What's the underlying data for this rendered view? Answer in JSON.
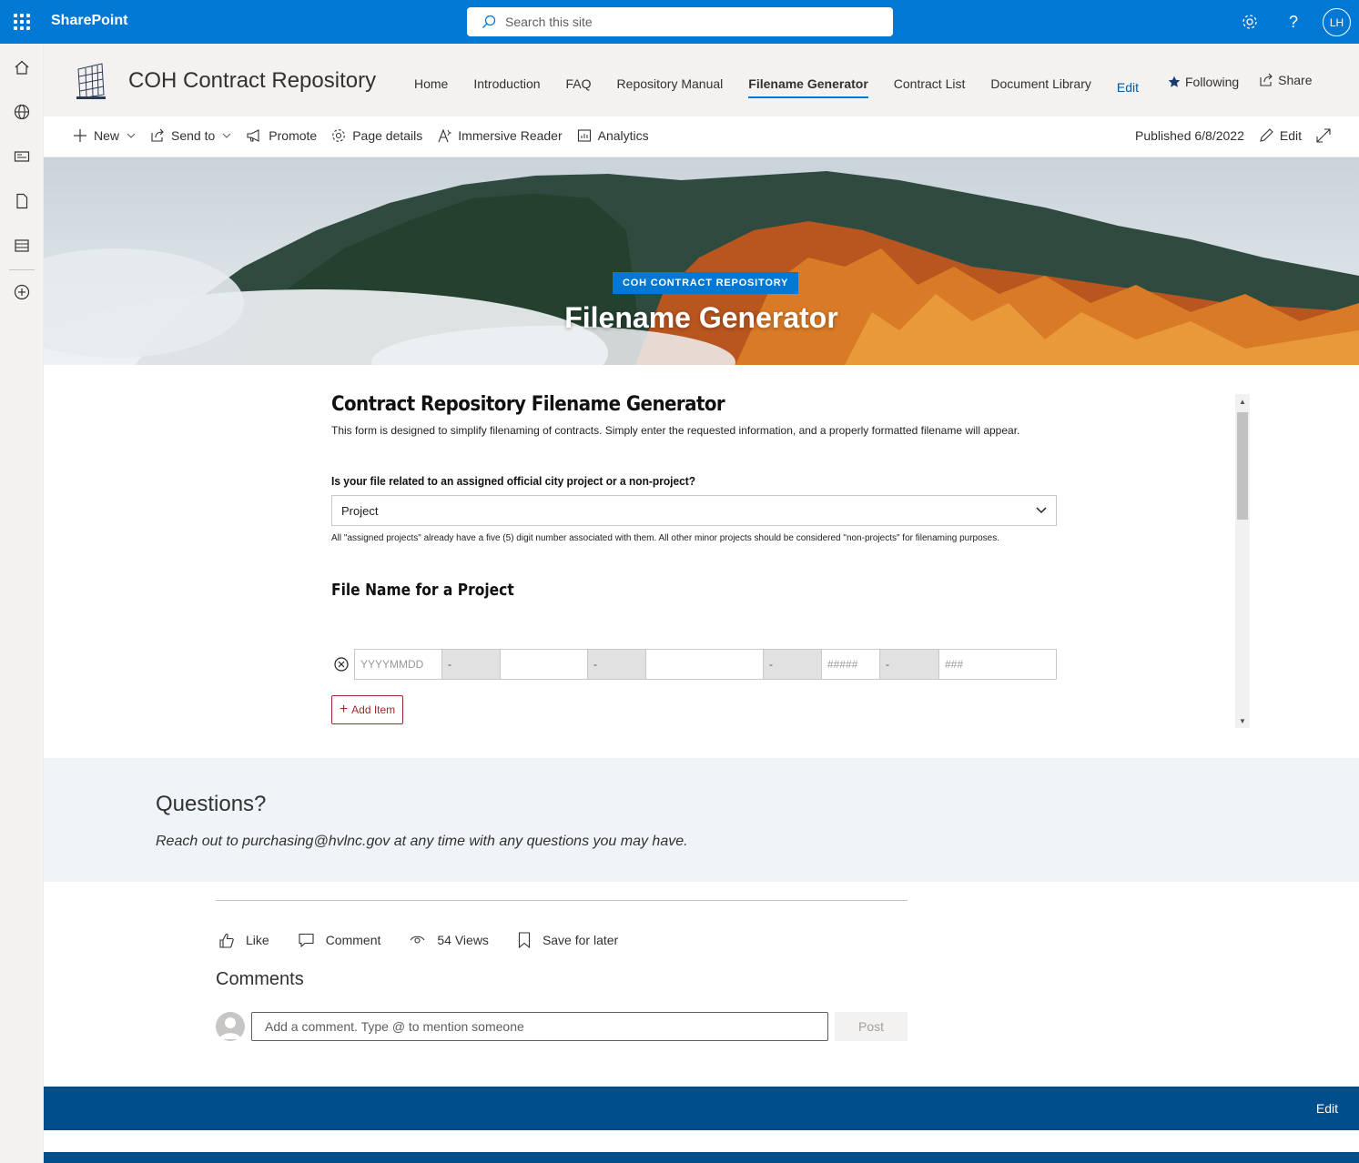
{
  "suite": {
    "brand": "SharePoint",
    "search_placeholder": "Search this site",
    "user_initials": "LH"
  },
  "site": {
    "title": "COH Contract Repository",
    "nav": [
      {
        "label": "Home",
        "active": false
      },
      {
        "label": "Introduction",
        "active": false
      },
      {
        "label": "FAQ",
        "active": false
      },
      {
        "label": "Repository Manual",
        "active": false
      },
      {
        "label": "Filename Generator",
        "active": true
      },
      {
        "label": "Contract List",
        "active": false
      },
      {
        "label": "Document Library",
        "active": false
      }
    ],
    "nav_edit": "Edit",
    "following": "Following",
    "share": "Share"
  },
  "commandbar": {
    "new": "New",
    "send_to": "Send to",
    "promote": "Promote",
    "page_details": "Page details",
    "immersive_reader": "Immersive Reader",
    "analytics": "Analytics",
    "published": "Published 6/8/2022",
    "edit": "Edit"
  },
  "hero": {
    "label": "COH CONTRACT REPOSITORY",
    "title": "Filename Generator"
  },
  "form": {
    "title": "Contract Repository Filename Generator",
    "description": "This form is designed to simplify filenaming of contracts. Simply enter the requested information, and a properly formatted filename will appear.",
    "question": "Is your file related to an assigned official city project or a non-project?",
    "selected": "Project",
    "hint": "All \"assigned projects\" already have a five (5) digit number associated with them. All other minor projects should be considered \"non-projects\" for filenaming purposes.",
    "section_title": "File Name for a Project",
    "fields": {
      "date_placeholder": "YYYYMMDD",
      "sep": "-",
      "num5_placeholder": "#####",
      "num3_placeholder": "###"
    },
    "add_item": "Add Item"
  },
  "questions": {
    "title": "Questions?",
    "text": "Reach out to purchasing@hvlnc.gov at any time with any questions you may have."
  },
  "social": {
    "like": "Like",
    "comment": "Comment",
    "views": "54 Views",
    "save": "Save for later",
    "comments_heading": "Comments",
    "comment_placeholder": "Add a comment. Type @ to mention someone",
    "post": "Post"
  },
  "footer": {
    "edit": "Edit"
  },
  "colors": {
    "suite_blue": "#0078d4",
    "footer_blue": "#004e8c",
    "add_item_red": "#a4262c"
  }
}
